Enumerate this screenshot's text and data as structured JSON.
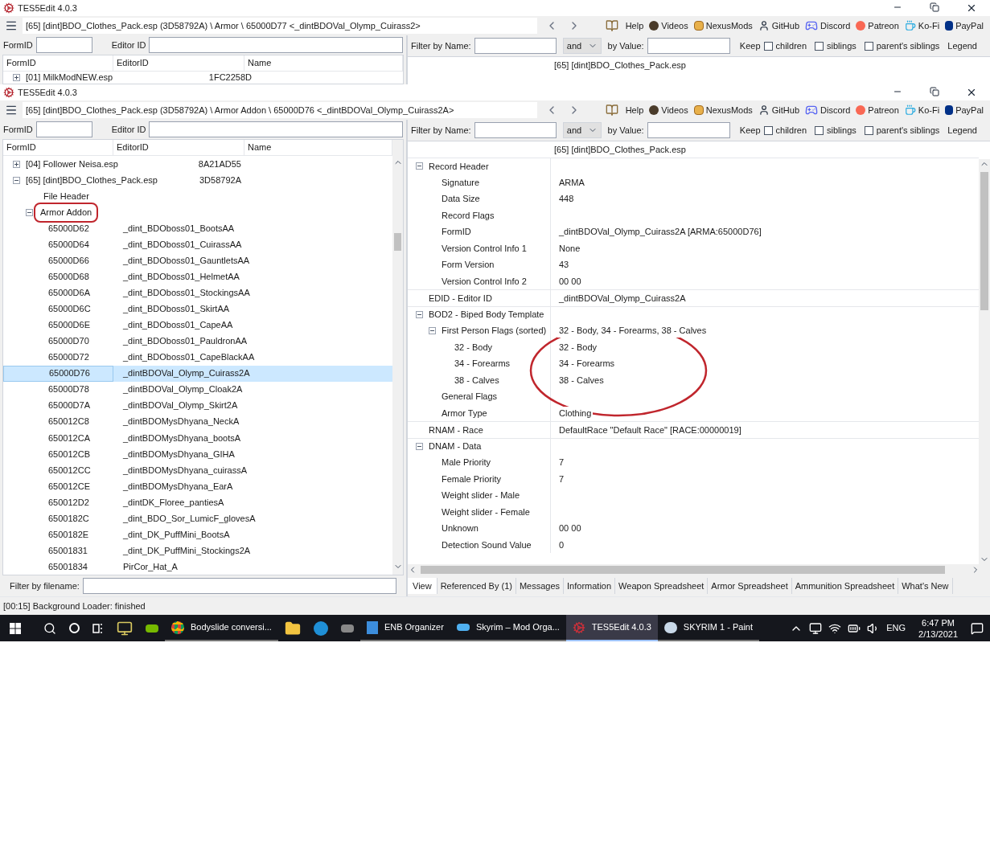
{
  "background_window": {
    "title": "TES5Edit 4.0.3",
    "path": "[65] [dint]BDO_Clothes_Pack.esp (3D58792A) \\ Armor \\ 65000D77 <_dintBDOVal_Olymp_Cuirass2>",
    "toolbar_links": [
      "Help",
      "Videos",
      "NexusMods",
      "GitHub",
      "Discord",
      "Patreon",
      "Ko-Fi",
      "PayPal"
    ],
    "filters": {
      "formid_label": "FormID",
      "editorid_label": "Editor ID",
      "name_label": "Filter by Name:",
      "operator": "and",
      "value_label": "by Value:",
      "keep_label": "Keep",
      "keep_options": [
        {
          "label": "children",
          "checked": false
        },
        {
          "label": "siblings",
          "checked": false
        },
        {
          "label": "parent's siblings",
          "checked": false
        }
      ],
      "legend": "Legend"
    },
    "tree_columns": [
      "FormID",
      "EditorID",
      "Name"
    ],
    "tree": [
      {
        "label": "[01] MilkModNEW.esp",
        "name": "1FC2258D",
        "expanded": false
      }
    ],
    "record_view": {
      "header": "[65] [dint]BDO_Clothes_Pack.esp"
    }
  },
  "main_window": {
    "title": "TES5Edit 4.0.3",
    "path": "[65] [dint]BDO_Clothes_Pack.esp (3D58792A) \\ Armor Addon \\ 65000D76 <_dintBDOVal_Olymp_Cuirass2A>",
    "toolbar_links": [
      "Help",
      "Videos",
      "NexusMods",
      "GitHub",
      "Discord",
      "Patreon",
      "Ko-Fi",
      "PayPal"
    ],
    "filters": {
      "formid_label": "FormID",
      "editorid_label": "Editor ID",
      "name_label": "Filter by Name:",
      "operator": "and",
      "value_label": "by Value:",
      "keep_label": "Keep",
      "keep_options": [
        {
          "label": "children",
          "checked": false
        },
        {
          "label": "siblings",
          "checked": false
        },
        {
          "label": "parent's siblings",
          "checked": false
        }
      ],
      "legend": "Legend"
    },
    "tree_columns": [
      "FormID",
      "EditorID",
      "Name"
    ],
    "tree": [
      {
        "label": "[04] Follower Neisa.esp",
        "name": "8A21AD55",
        "expanded": false
      },
      {
        "label": "[65] [dint]BDO_Clothes_Pack.esp",
        "name": "3D58792A",
        "expanded": true,
        "children": [
          {
            "label": "File Header",
            "highlighted": false
          },
          {
            "label": "Armor Addon",
            "highlighted": true,
            "expanded": true,
            "children": [
              {
                "formid": "65000D62",
                "editorid": "_dint_BDOboss01_BootsAA",
                "selected": false
              },
              {
                "formid": "65000D64",
                "editorid": "_dint_BDOboss01_CuirassAA",
                "selected": false
              },
              {
                "formid": "65000D66",
                "editorid": "_dint_BDOboss01_GauntletsAA",
                "selected": false
              },
              {
                "formid": "65000D68",
                "editorid": "_dint_BDOboss01_HelmetAA",
                "selected": false
              },
              {
                "formid": "65000D6A",
                "editorid": "_dint_BDOboss01_StockingsAA",
                "selected": false
              },
              {
                "formid": "65000D6C",
                "editorid": "_dint_BDOboss01_SkirtAA",
                "selected": false
              },
              {
                "formid": "65000D6E",
                "editorid": "_dint_BDOboss01_CapeAA",
                "selected": false
              },
              {
                "formid": "65000D70",
                "editorid": "_dint_BDOboss01_PauldronAA",
                "selected": false
              },
              {
                "formid": "65000D72",
                "editorid": "_dint_BDOboss01_CapeBlackAA",
                "selected": false
              },
              {
                "formid": "65000D76",
                "editorid": "_dintBDOVal_Olymp_Cuirass2A",
                "selected": true
              },
              {
                "formid": "65000D78",
                "editorid": "_dintBDOVal_Olymp_Cloak2A",
                "selected": false
              },
              {
                "formid": "65000D7A",
                "editorid": "_dintBDOVal_Olymp_Skirt2A",
                "selected": false
              },
              {
                "formid": "650012C8",
                "editorid": "_dintBDOMysDhyana_NeckA",
                "selected": false
              },
              {
                "formid": "650012CA",
                "editorid": "_dintBDOMysDhyana_bootsA",
                "selected": false
              },
              {
                "formid": "650012CB",
                "editorid": "_dintBDOMysDhyana_GIHA",
                "selected": false
              },
              {
                "formid": "650012CC",
                "editorid": "_dintBDOMysDhyana_cuirassA",
                "selected": false
              },
              {
                "formid": "650012CE",
                "editorid": "_dintBDOMysDhyana_EarA",
                "selected": false
              },
              {
                "formid": "650012D2",
                "editorid": "_dintDK_Floree_pantiesA",
                "selected": false
              },
              {
                "formid": "6500182C",
                "editorid": "_dint_BDO_Sor_LumicF_glovesA",
                "selected": false
              },
              {
                "formid": "6500182E",
                "editorid": "_dint_DK_PuffMini_BootsA",
                "selected": false
              },
              {
                "formid": "65001831",
                "editorid": "_dint_DK_PuffMini_Stockings2A",
                "selected": false
              },
              {
                "formid": "65001834",
                "editorid": "PirCor_Hat_A",
                "selected": false
              }
            ]
          }
        ]
      }
    ],
    "record_view": {
      "header": "[65] [dint]BDO_Clothes_Pack.esp",
      "annotations": [
        {
          "kind": "ellipse"
        }
      ],
      "fields": [
        {
          "label": "Record Header",
          "expanded": true,
          "children": [
            {
              "label": "Signature",
              "value": "ARMA"
            },
            {
              "label": "Data Size",
              "value": "448"
            },
            {
              "label": "Record Flags"
            },
            {
              "label": "FormID",
              "value": "_dintBDOVal_Olymp_Cuirass2A [ARMA:65000D76]"
            },
            {
              "label": "Version Control Info 1",
              "value": "None"
            },
            {
              "label": "Form Version",
              "value": "43"
            },
            {
              "label": "Version Control Info 2",
              "value": "00 00"
            }
          ]
        },
        {
          "label": "EDID - Editor ID",
          "value": "_dintBDOVal_Olymp_Cuirass2A"
        },
        {
          "label": "BOD2 - Biped Body Template",
          "expanded": true,
          "children": [
            {
              "label": "First Person Flags (sorted)",
              "value": "32 - Body, 34 - Forearms, 38 - Calves",
              "expanded": true,
              "children": [
                {
                  "label": "32 - Body",
                  "value": "32 - Body"
                },
                {
                  "label": "34 - Forearms",
                  "value": "34 - Forearms"
                },
                {
                  "label": "38 - Calves",
                  "value": "38 - Calves"
                }
              ]
            },
            {
              "label": "General Flags"
            },
            {
              "label": "Armor Type",
              "value": "Clothing"
            }
          ]
        },
        {
          "label": "RNAM - Race",
          "value": "DefaultRace \"Default Race\" [RACE:00000019]"
        },
        {
          "label": "DNAM - Data",
          "expanded": true,
          "children": [
            {
              "label": "Male Priority",
              "value": "7"
            },
            {
              "label": "Female Priority",
              "value": "7"
            },
            {
              "label": "Weight slider - Male"
            },
            {
              "label": "Weight slider - Female"
            },
            {
              "label": "Unknown",
              "value": "00 00"
            },
            {
              "label": "Detection Sound Value",
              "value": "0"
            }
          ]
        }
      ]
    },
    "filename_filter_label": "Filter by filename:",
    "tabs": [
      {
        "label": "View",
        "selected": true
      },
      {
        "label": "Referenced By (1)",
        "selected": false
      },
      {
        "label": "Messages",
        "selected": false
      },
      {
        "label": "Information",
        "selected": false
      },
      {
        "label": "Weapon Spreadsheet",
        "selected": false
      },
      {
        "label": "Armor Spreadsheet",
        "selected": false
      },
      {
        "label": "Ammunition Spreadsheet",
        "selected": false
      },
      {
        "label": "What's New",
        "selected": false
      }
    ],
    "status": "[00:15] Background Loader: finished"
  },
  "taskbar": {
    "items": [
      {
        "label": "Bodyslide conversi...",
        "selected": false
      },
      {
        "label": "ENB Organizer",
        "selected": false
      },
      {
        "label": "Skyrim – Mod Orga...",
        "selected": false
      },
      {
        "label": "TES5Edit 4.0.3",
        "selected": true
      },
      {
        "label": "SKYRIM  1 - Paint",
        "selected": false
      }
    ],
    "language": "ENG",
    "time": "6:47 PM",
    "date": "2/13/2021"
  }
}
